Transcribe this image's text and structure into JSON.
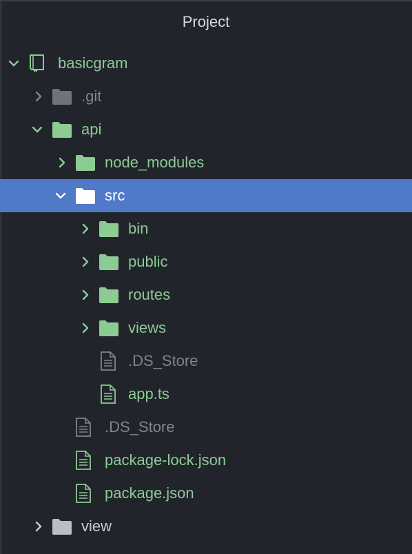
{
  "panel": {
    "title": "Project"
  },
  "colors": {
    "background": "#21252b",
    "selection": "#5079c8",
    "tracked_green": "#8dcb94",
    "ignored_gray": "#7f848e"
  },
  "tree": [
    {
      "label": "basicgram",
      "kind": "repo",
      "expanded": true,
      "status": "tracked",
      "icon": "book-icon"
    },
    {
      "label": ".git",
      "kind": "folder",
      "expanded": false,
      "status": "ignored",
      "icon": "folder-icon"
    },
    {
      "label": "api",
      "kind": "folder",
      "expanded": true,
      "status": "tracked",
      "icon": "folder-icon"
    },
    {
      "label": "node_modules",
      "kind": "folder",
      "expanded": false,
      "status": "tracked",
      "icon": "folder-icon"
    },
    {
      "label": "src",
      "kind": "folder",
      "expanded": true,
      "status": "selected",
      "icon": "folder-icon"
    },
    {
      "label": "bin",
      "kind": "folder",
      "expanded": false,
      "status": "tracked",
      "icon": "folder-icon"
    },
    {
      "label": "public",
      "kind": "folder",
      "expanded": false,
      "status": "tracked",
      "icon": "folder-icon"
    },
    {
      "label": "routes",
      "kind": "folder",
      "expanded": false,
      "status": "tracked",
      "icon": "folder-icon"
    },
    {
      "label": "views",
      "kind": "folder",
      "expanded": false,
      "status": "tracked",
      "icon": "folder-icon"
    },
    {
      "label": ".DS_Store",
      "kind": "file",
      "status": "ignored",
      "icon": "file-icon"
    },
    {
      "label": "app.ts",
      "kind": "file",
      "status": "tracked",
      "icon": "file-icon"
    },
    {
      "label": ".DS_Store",
      "kind": "file",
      "status": "ignored",
      "icon": "file-icon"
    },
    {
      "label": "package-lock.json",
      "kind": "file",
      "status": "tracked",
      "icon": "file-icon"
    },
    {
      "label": "package.json",
      "kind": "file",
      "status": "tracked",
      "icon": "file-icon"
    },
    {
      "label": "view",
      "kind": "folder",
      "expanded": false,
      "status": "default",
      "icon": "folder-icon"
    }
  ]
}
